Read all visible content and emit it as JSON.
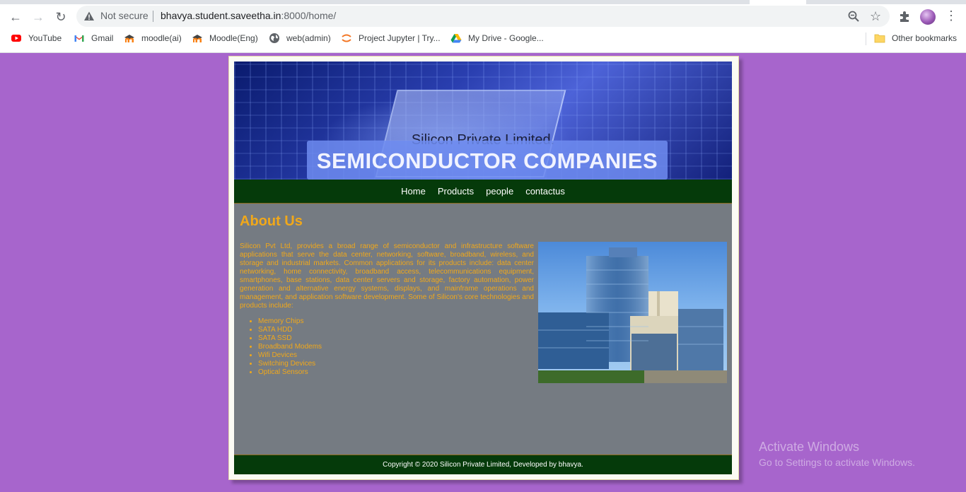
{
  "browser": {
    "url_host": "bhavya.student.saveetha.in",
    "url_path": ":8000/home/",
    "security_label": "Not secure",
    "bookmarks": [
      {
        "label": "YouTube",
        "icon": "youtube-icon"
      },
      {
        "label": "Gmail",
        "icon": "gmail-icon"
      },
      {
        "label": "moodle(ai)",
        "icon": "moodle-icon"
      },
      {
        "label": "Moodle(Eng)",
        "icon": "moodle-icon"
      },
      {
        "label": "web(admin)",
        "icon": "globe-icon"
      },
      {
        "label": "Project Jupyter | Try...",
        "icon": "jupyter-icon"
      },
      {
        "label": "My Drive - Google...",
        "icon": "google-drive-icon"
      }
    ],
    "other_bookmarks": "Other bookmarks"
  },
  "site": {
    "company_name": "Silicon Private Limited.",
    "banner_heading": "SEMICONDUCTOR COMPANIES",
    "nav": [
      "Home",
      "Products",
      "people",
      "contactus"
    ],
    "about_title": "About Us",
    "about_text": "Silicon Pvt Ltd, provides a broad range of semiconductor and infrastructure software applications that serve the data center, networking, software, broadband, wireless, and storage and industrial markets. Common applications for its products include: data center networking, home connectivity, broadband access, telecommunications equipment, smartphones, base stations, data center servers and storage, factory automation, power generation and alternative energy systems, displays, and mainframe operations and management, and application software development. Some of Silicon's core technologies and products include:",
    "products": [
      "Memory Chips",
      "SATA HDD",
      "SATA SSD",
      "Broadband Modems",
      "Wifi Devices",
      "Switching Devices",
      "Optical Sensors"
    ],
    "footer": "Copyright © 2020 Silicon Private Limited, Developed by bhavya."
  },
  "os_watermark": {
    "title": "Activate Windows",
    "subtitle": "Go to Settings to activate Windows."
  },
  "colors": {
    "page_background": "#a765cc",
    "nav_background": "#053a0a",
    "content_background": "#757b82",
    "accent_text": "#f1a81a"
  }
}
